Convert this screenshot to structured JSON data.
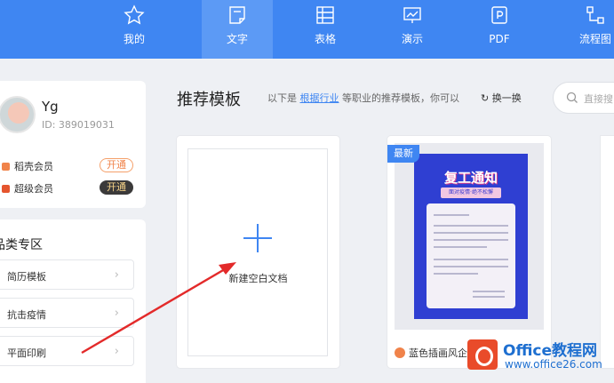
{
  "nav": {
    "tabs": [
      {
        "label": "我的",
        "icon": "star-icon"
      },
      {
        "label": "文字",
        "icon": "document-icon",
        "active": true
      },
      {
        "label": "表格",
        "icon": "table-icon"
      },
      {
        "label": "演示",
        "icon": "presentation-icon"
      },
      {
        "label": "PDF",
        "icon": "pdf-icon"
      },
      {
        "label": "流程图",
        "icon": "flowchart-icon"
      }
    ]
  },
  "profile": {
    "name": "Yg",
    "id_text": "ID: 389019031",
    "memberships": [
      {
        "label": "稻壳会员",
        "action": "开通",
        "color": "#f0834a"
      },
      {
        "label": "超级会员",
        "action": "开通",
        "color": "#e5552e"
      }
    ]
  },
  "categories": {
    "title": "品类专区",
    "items": [
      "简历模板",
      "抗击疫情",
      "平面印刷"
    ]
  },
  "main": {
    "title": "推荐模板",
    "hint_prefix": "以下是",
    "hint_link": "根据行业",
    "hint_suffix": "等职业的推荐模板，你可以",
    "refresh_label": "换一换",
    "search_placeholder": "直接搜"
  },
  "new_doc": {
    "label": "新建空白文档"
  },
  "template": {
    "badge": "最新",
    "poster_title": "复工通知",
    "poster_subtitle": "面对疫情·绝不松懈",
    "name": "蓝色插画风企"
  },
  "watermark": {
    "title": "Office教程网",
    "url": "www.office26.com"
  },
  "colors": {
    "nav_bg": "#3f86f2",
    "accent": "#3f86f2",
    "annotation_arrow": "#e32a2a"
  }
}
